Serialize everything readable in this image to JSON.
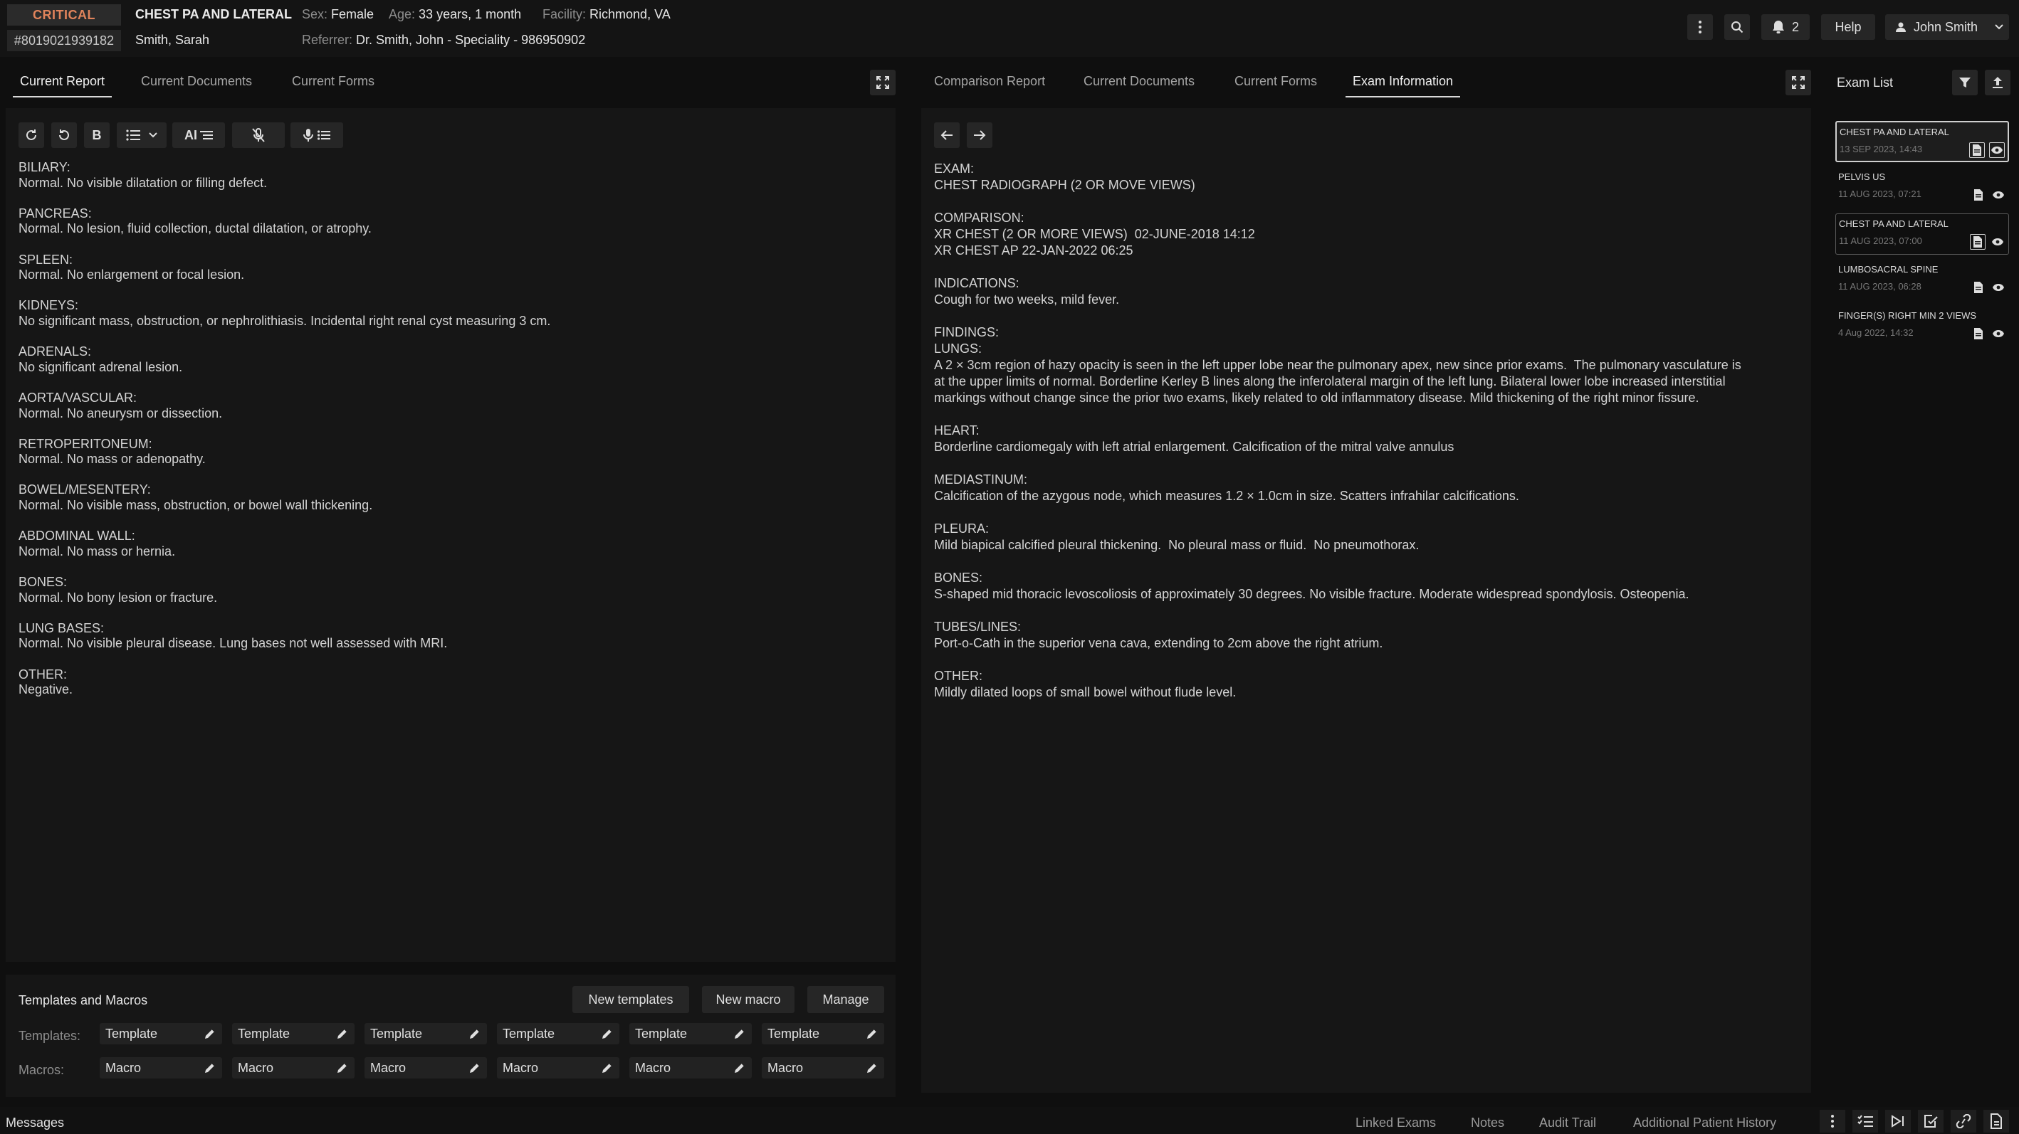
{
  "header": {
    "status": "CRITICAL",
    "accession": "#8019021939182",
    "exam_title": "CHEST PA AND LATERAL",
    "patient_name": "Smith, Sarah",
    "sex_label": "Sex:",
    "sex": "Female",
    "age_label": "Age:",
    "age": "33 years, 1 month",
    "facility_label": "Facility:",
    "facility": "Richmond, VA",
    "referrer_label": "Referrer:",
    "referrer": "Dr. Smith, John - Speciality - 986950902",
    "notifications_count": "2",
    "help_label": "Help",
    "user_name": "John Smith",
    "status_color": "#e0835b"
  },
  "left_panel": {
    "tabs": [
      "Current Report",
      "Current Documents",
      "Current Forms"
    ],
    "active_tab": "Current Report",
    "toolbar": {
      "bold": "B",
      "ai": "AI"
    },
    "report_sections": [
      {
        "heading": "BILIARY:",
        "text": "Normal. No visible dilatation or filling defect."
      },
      {
        "heading": "PANCREAS:",
        "text": "Normal. No lesion, fluid collection, ductal dilatation, or atrophy."
      },
      {
        "heading": "SPLEEN:",
        "text": "Normal. No enlargement or focal lesion."
      },
      {
        "heading": "KIDNEYS:",
        "text": "No significant mass, obstruction, or nephrolithiasis. Incidental right renal cyst measuring 3 cm."
      },
      {
        "heading": "ADRENALS:",
        "text": "No significant adrenal lesion."
      },
      {
        "heading": "AORTA/VASCULAR:",
        "text": "Normal. No aneurysm or dissection."
      },
      {
        "heading": "RETROPERITONEUM:",
        "text": "Normal. No mass or adenopathy."
      },
      {
        "heading": "BOWEL/MESENTERY:",
        "text": "Normal. No visible mass, obstruction, or bowel wall thickening."
      },
      {
        "heading": "ABDOMINAL WALL:",
        "text": "Normal. No mass or hernia."
      },
      {
        "heading": "BONES:",
        "text": "Normal. No bony lesion or fracture."
      },
      {
        "heading": "LUNG BASES:",
        "text": "Normal. No visible pleural disease. Lung bases not well assessed with MRI."
      },
      {
        "heading": "OTHER:",
        "text": "Negative."
      }
    ]
  },
  "templates": {
    "title": "Templates and Macros",
    "new_templates": "New templates",
    "new_macro": "New macro",
    "manage": "Manage",
    "templates_label": "Templates:",
    "macros_label": "Macros:",
    "template_items": [
      "Template",
      "Template",
      "Template",
      "Template",
      "Template",
      "Template"
    ],
    "macro_items": [
      "Macro",
      "Macro",
      "Macro",
      "Macro",
      "Macro",
      "Macro"
    ]
  },
  "right_panel": {
    "tabs": [
      "Comparison Report",
      "Current Documents",
      "Current Forms",
      "Exam Information"
    ],
    "active_tab": "Exam Information",
    "sections": [
      {
        "lines": [
          "EXAM:",
          "CHEST RADIOGRAPH (2 OR MOVE VIEWS)"
        ]
      },
      {
        "lines": [
          "COMPARISON:",
          "XR CHEST (2 OR MORE VIEWS)  02-JUNE-2018 14:12",
          "XR CHEST AP 22-JAN-2022 06:25"
        ]
      },
      {
        "lines": [
          "INDICATIONS:",
          "Cough for two weeks, mild fever."
        ]
      },
      {
        "lines": [
          "FINDINGS:",
          "LUNGS:",
          "A 2 × 3cm region of hazy opacity is seen in the left upper lobe near the pulmonary apex, new since prior exams.  The pulmonary vasculature is",
          "at the upper limits of normal. Borderline Kerley B lines along the inferolateral margin of the left lung. Bilateral lower lobe increased interstitial",
          "markings without change since the prior two exams, likely related to old inflammatory disease. Mild thickening of the right minor fissure."
        ]
      },
      {
        "lines": [
          "HEART:",
          "Borderline cardiomegaly with left atrial enlargement. Calcification of the mitral valve annulus"
        ]
      },
      {
        "lines": [
          "MEDIASTINUM:",
          "Calcification of the azygous node, which measures 1.2 × 1.0cm in size. Scatters infrahilar calcifications."
        ]
      },
      {
        "lines": [
          "PLEURA:",
          "Mild biapical calcified pleural thickening.  No pleural mass or fluid.  No pneumothorax."
        ]
      },
      {
        "lines": [
          "BONES:",
          "S-shaped mid thoracic levoscoliosis of approximately 30 degrees. No visible fracture. Moderate widespread spondylosis. Osteopenia."
        ]
      },
      {
        "lines": [
          "TUBES/LINES:",
          "Port-o-Cath in the superior vena cava, extending to 2cm above the right atrium."
        ]
      },
      {
        "lines": [
          "OTHER:",
          "Mildly dilated loops of small bowel without flude level."
        ]
      }
    ]
  },
  "exam_list": {
    "title": "Exam List",
    "items": [
      {
        "name": "CHEST PA AND LATERAL",
        "date": "13 SEP 2023, 14:43"
      },
      {
        "name": "PELVIS US",
        "date": "11 AUG 2023, 07:21"
      },
      {
        "name": "CHEST PA AND LATERAL",
        "date": "11 AUG 2023, 07:00"
      },
      {
        "name": "LUMBOSACRAL SPINE",
        "date": "11 AUG 2023, 06:28"
      },
      {
        "name": "FINGER(S) RIGHT MIN 2 VIEWS",
        "date": "4 Aug 2022, 14:32"
      }
    ]
  },
  "footer": {
    "messages": "Messages",
    "links": [
      "Linked Exams",
      "Notes",
      "Audit Trail",
      "Additional Patient History"
    ]
  }
}
